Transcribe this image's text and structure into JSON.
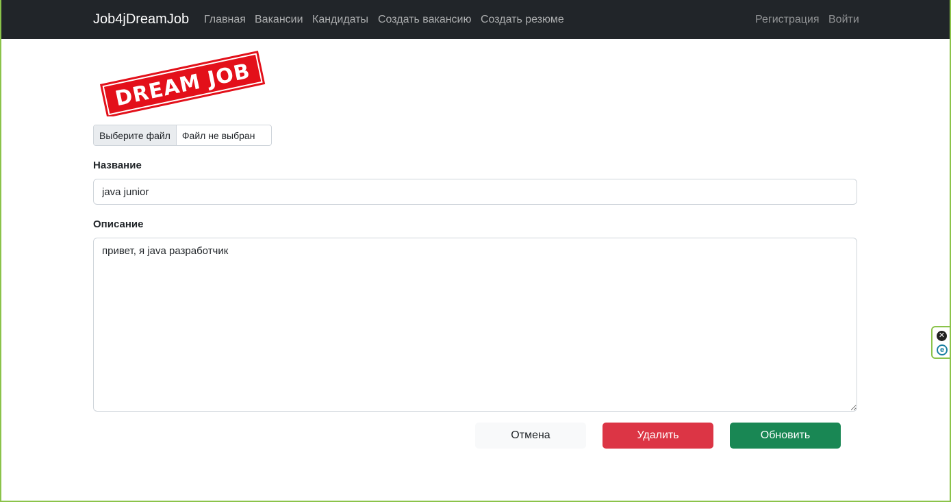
{
  "navbar": {
    "brand": "Job4jDreamJob",
    "links": [
      {
        "label": "Главная"
      },
      {
        "label": "Вакансии"
      },
      {
        "label": "Кандидаты"
      },
      {
        "label": "Создать вакансию"
      },
      {
        "label": "Создать резюме"
      }
    ],
    "auth": {
      "register": "Регистрация",
      "login": "Войти"
    },
    "background": "#212529"
  },
  "logo": {
    "text": "DREAM JOB",
    "color": "#e3101a"
  },
  "file_input": {
    "button_label": "Выберите файл",
    "status": "Файл не выбран"
  },
  "form": {
    "title_label": "Название",
    "title_value": "java junior",
    "description_label": "Описание",
    "description_value": "привет, я java разработчик"
  },
  "buttons": {
    "cancel": "Отмена",
    "delete": "Удалить",
    "update": "Обновить"
  },
  "colors": {
    "danger": "#dc3545",
    "success": "#198754",
    "light": "#f8f9fa"
  },
  "extension": {
    "close_icon": "close-icon",
    "e_icon": "e-icon"
  }
}
